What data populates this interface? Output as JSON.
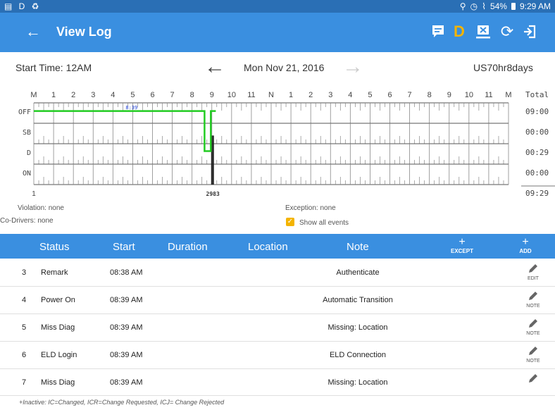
{
  "status_bar": {
    "left_icons": "▤ D ♻",
    "battery": "54%",
    "time": "9:29 AM",
    "wifi": "⌇"
  },
  "app_bar": {
    "title": "View Log",
    "back_icon": "back-arrow-icon",
    "actions": [
      "message-icon",
      "driver-d-icon",
      "certify-icon",
      "refresh-icon",
      "logout-icon"
    ],
    "driver_letter": "D"
  },
  "log": {
    "start_time": "Start Time: 12AM",
    "date": "Mon Nov 21, 2016",
    "cycle": "US70hr8days"
  },
  "graph": {
    "hours": [
      "M",
      "1",
      "2",
      "3",
      "4",
      "5",
      "6",
      "7",
      "8",
      "9",
      "10",
      "11",
      "N",
      "1",
      "2",
      "3",
      "4",
      "5",
      "6",
      "7",
      "8",
      "9",
      "10",
      "11",
      "M"
    ],
    "total_label": "Total",
    "rows": [
      {
        "label": "OFF",
        "total": "09:00"
      },
      {
        "label": "SB",
        "total": "00:00"
      },
      {
        "label": "D",
        "total": "00:29"
      },
      {
        "label": "ON",
        "total": "00:00"
      }
    ],
    "grand_total": "09:29",
    "marker_time": "8:39",
    "bottom_left": "1",
    "bottom_marker": "2983",
    "segments": [
      {
        "status": "OFF",
        "from": 0,
        "to": 8.63
      },
      {
        "status": "D",
        "from": 8.63,
        "to": 8.95
      },
      {
        "status": "OFF",
        "from": 8.95,
        "to": 9.2
      }
    ],
    "events_at": [
      9.0,
      9.07
    ]
  },
  "info": {
    "violation": "Violation: none",
    "exception": "Exception: none",
    "co_drivers": "Co-Drivers: none",
    "show_all": "Show all events",
    "show_all_checked": true
  },
  "table": {
    "headers": {
      "status": "Status",
      "start": "Start",
      "duration": "Duration",
      "location": "Location",
      "note": "Note",
      "except": "EXCEPT",
      "add": "ADD"
    },
    "rows": [
      {
        "num": "3",
        "status": "Remark",
        "start": "08:38 AM",
        "note": "Authenticate",
        "action": "EDIT"
      },
      {
        "num": "4",
        "status": "Power On",
        "start": "08:39 AM",
        "note": "Automatic Transition",
        "action": "NOTE"
      },
      {
        "num": "5",
        "status": "Miss Diag",
        "start": "08:39 AM",
        "note": "Missing: Location",
        "action": "NOTE"
      },
      {
        "num": "6",
        "status": "ELD Login",
        "start": "08:39 AM",
        "note": "ELD Connection",
        "action": "NOTE"
      },
      {
        "num": "7",
        "status": "Miss Diag",
        "start": "08:39 AM",
        "note": "Missing: Location",
        "action": "NOTE"
      }
    ]
  },
  "footer": "+Inactive: IC=Changed, ICR=Change Requested, ICJ= Change Rejected",
  "colors": {
    "primary": "#3a8fe0",
    "status_bar": "#2a6fb5",
    "accent": "#f4b400",
    "graph_line": "#22cc22"
  }
}
